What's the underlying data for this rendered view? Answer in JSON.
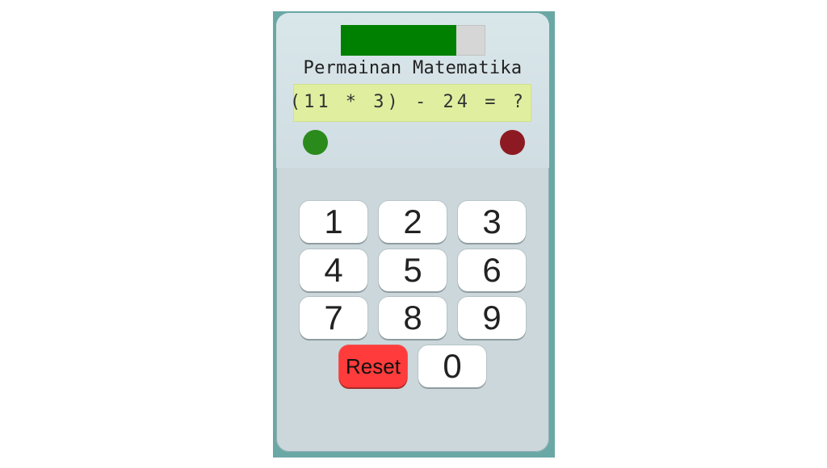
{
  "progress": {
    "value": 0.8,
    "fill_color": "#008000",
    "track_color": "#d6d6d6"
  },
  "title": "Permainan Matematika",
  "display": {
    "expression": "(11 * 3) - 24 = ?"
  },
  "indicators": {
    "correct_color": "#2b8a1c",
    "wrong_color": "#8d1a22"
  },
  "keys": [
    {
      "label": "1"
    },
    {
      "label": "2"
    },
    {
      "label": "3"
    },
    {
      "label": "4"
    },
    {
      "label": "5"
    },
    {
      "label": "6"
    },
    {
      "label": "7"
    },
    {
      "label": "8"
    },
    {
      "label": "9"
    },
    {
      "label": "Reset"
    },
    {
      "label": "0"
    }
  ]
}
